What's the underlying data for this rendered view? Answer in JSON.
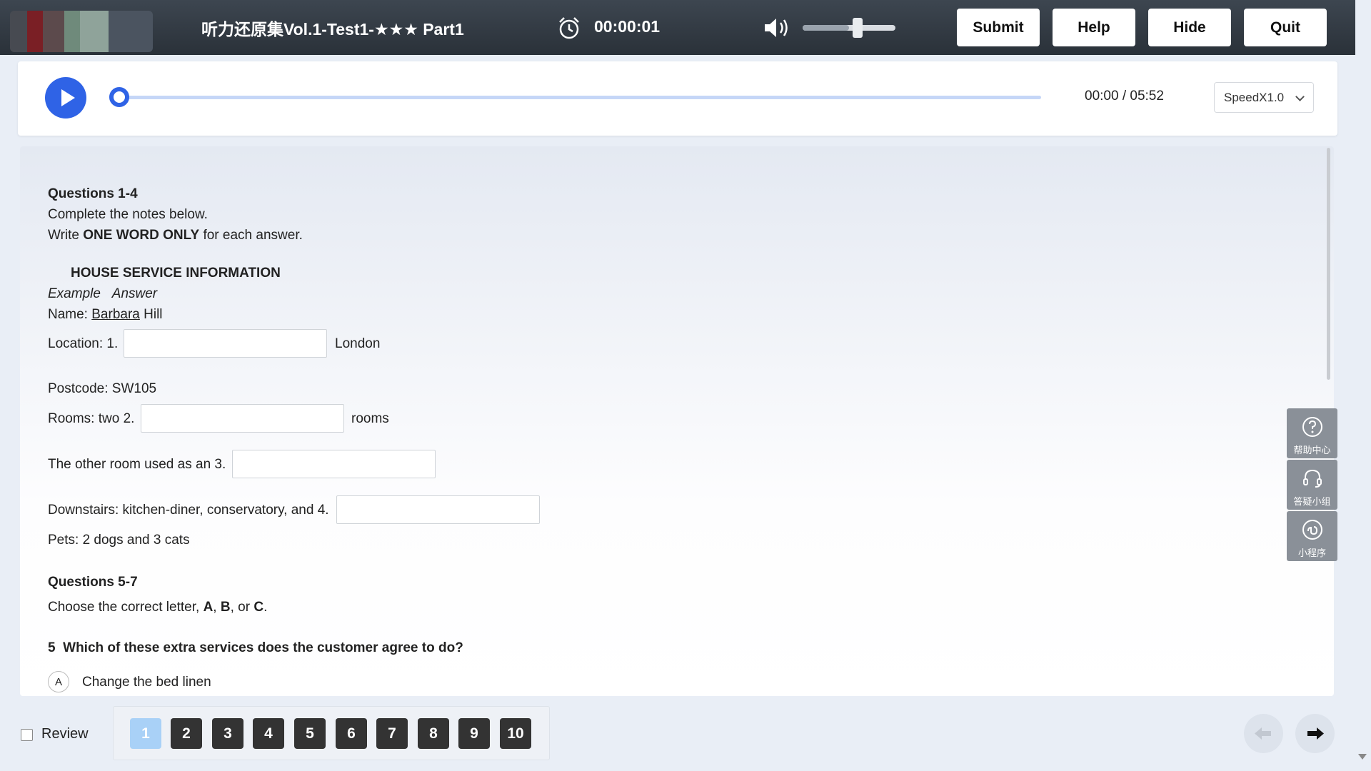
{
  "header": {
    "title": "听力还原集Vol.1-Test1-★★★ Part1",
    "timer": "00:00:01",
    "buttons": {
      "submit": "Submit",
      "help": "Help",
      "hide": "Hide",
      "quit": "Quit"
    },
    "volume_level": 0.5
  },
  "audio": {
    "time": "00:00 / 05:52",
    "speed": "SpeedX1.0",
    "progress": 0
  },
  "content": {
    "q1_4_heading": "Questions 1-4",
    "q1_4_instr1": "Complete the notes below.",
    "q1_4_instr2_pre": "Write ",
    "q1_4_instr2_bold": "ONE WORD ONLY",
    "q1_4_instr2_post": " for each answer.",
    "notes_title": "HOUSE SERVICE INFORMATION",
    "example_label": "Example",
    "answer_label": "Answer",
    "name_pre": "Name: ",
    "name_underlined": "Barbara",
    "name_post": " Hill",
    "location_pre": "Location: 1.",
    "location_post": "London",
    "postcode": "Postcode: SW105",
    "rooms_pre": "Rooms: two 2.",
    "rooms_post": "rooms",
    "other_room_pre": "The other room used as an 3.",
    "downstairs_pre": "Downstairs: kitchen-diner, conservatory, and 4.",
    "pets": "Pets: 2 dogs and 3 cats",
    "q5_7_heading": "Questions 5-7",
    "q5_7_instr_pre": "Choose the correct letter, ",
    "letter_a": "A",
    "letter_sep1": ", ",
    "letter_b": "B",
    "letter_sep2": ", or ",
    "letter_c": "C",
    "letter_end": ".",
    "q5_num": "5",
    "q5_text": "Which of these extra services does the customer agree to do?",
    "q5_option_a_letter": "A",
    "q5_option_a_text": "Change the bed linen"
  },
  "side_widgets": {
    "help_center": "帮助中心",
    "qa_group": "答疑小组",
    "mini_program": "小程序"
  },
  "footer": {
    "review_label": "Review",
    "question_numbers": [
      "1",
      "2",
      "3",
      "4",
      "5",
      "6",
      "7",
      "8",
      "9",
      "10"
    ]
  }
}
